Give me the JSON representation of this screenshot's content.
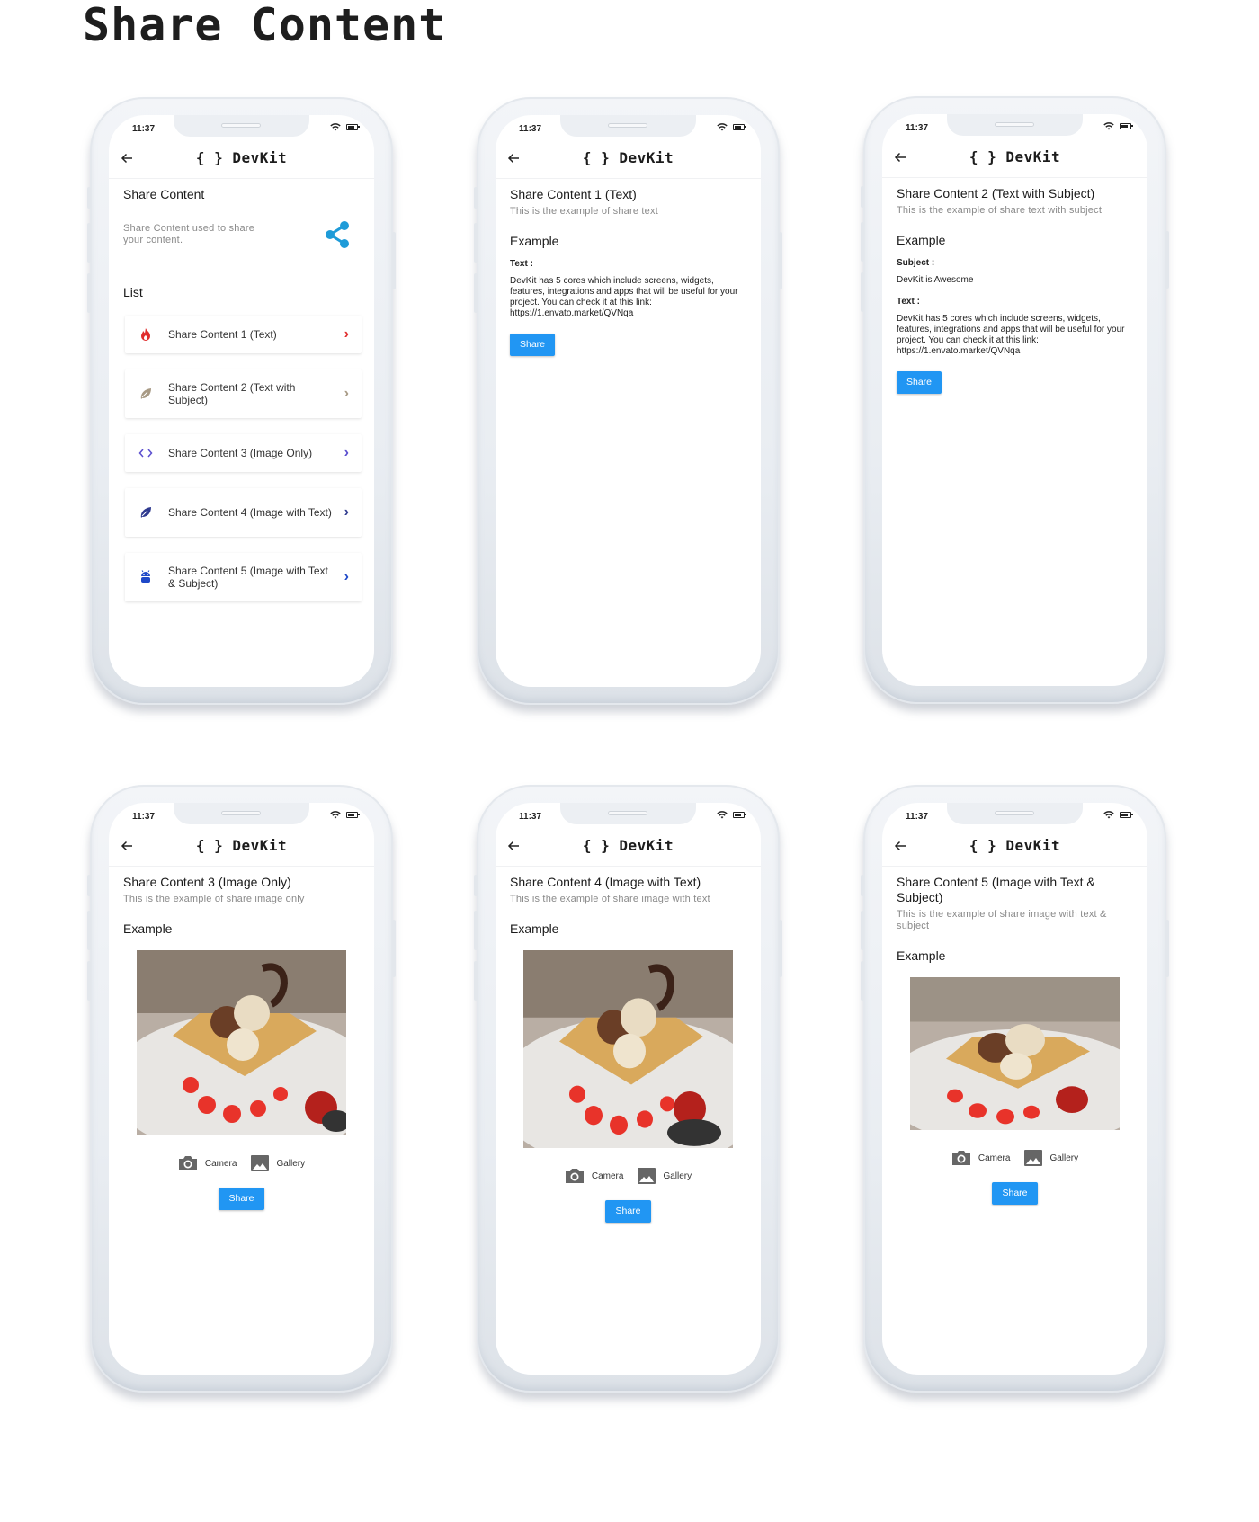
{
  "page": {
    "title": "Share Content"
  },
  "common": {
    "time": "11:37",
    "brand": "{ } DevKit",
    "share_label": "Share",
    "camera_label": "Camera",
    "gallery_label": "Gallery",
    "example_label": "Example",
    "text_label": "Text :",
    "subject_label": "Subject :",
    "share_text": "DevKit has 5 cores which include screens, widgets, features, integrations and apps that will be useful for your project. You can check it at this link: https://1.envato.market/QVNqa",
    "subject_text": "DevKit is Awesome"
  },
  "colors": {
    "accent": "#2196f3",
    "share_icon": "#1e9bd8",
    "item1": "#e02d2d",
    "item2": "#a89a85",
    "item3": "#5b4fcf",
    "item4": "#2f3a8f",
    "item5": "#1e48c8"
  },
  "screen1": {
    "title": "Share Content",
    "description": "Share Content used to share your content.",
    "list_heading": "List",
    "items": [
      {
        "label": "Share Content 1 (Text)",
        "icon": "fire-icon"
      },
      {
        "label": "Share Content 2 (Text with Subject)",
        "icon": "leaf-icon"
      },
      {
        "label": "Share Content 3 (Image Only)",
        "icon": "code-icon"
      },
      {
        "label": "Share Content 4 (Image with Text)",
        "icon": "leaf-icon"
      },
      {
        "label": "Share Content 5 (Image with Text & Subject)",
        "icon": "android-icon"
      }
    ]
  },
  "screen2": {
    "title": "Share Content 1 (Text)",
    "subtitle": "This is the example of share text"
  },
  "screen3": {
    "title": "Share Content 2 (Text with Subject)",
    "subtitle": "This is the example of share text with subject"
  },
  "screen4": {
    "title": "Share Content 3 (Image Only)",
    "subtitle": "This is the example of share image only"
  },
  "screen5": {
    "title": "Share Content 4 (Image with Text)",
    "subtitle": "This is the example of share image with text"
  },
  "screen6": {
    "title": "Share Content 5 (Image with Text & Subject)",
    "subtitle": "This is the example of share image with text & subject"
  }
}
